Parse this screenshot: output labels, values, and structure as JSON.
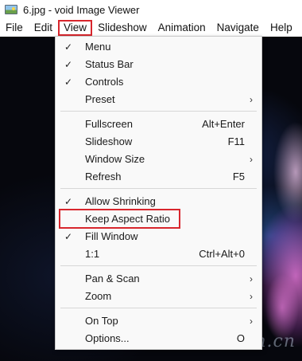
{
  "window": {
    "title": "6.jpg - void Image Viewer"
  },
  "menubar": {
    "items": [
      {
        "label": "File"
      },
      {
        "label": "Edit"
      },
      {
        "label": "View"
      },
      {
        "label": "Slideshow"
      },
      {
        "label": "Animation"
      },
      {
        "label": "Navigate"
      },
      {
        "label": "Help"
      }
    ]
  },
  "view_menu": {
    "items": [
      {
        "label": "Menu",
        "checked": "✓",
        "shortcut": "",
        "arrow": ""
      },
      {
        "label": "Status Bar",
        "checked": "✓",
        "shortcut": "",
        "arrow": ""
      },
      {
        "label": "Controls",
        "checked": "✓",
        "shortcut": "",
        "arrow": ""
      },
      {
        "label": "Preset",
        "checked": "",
        "shortcut": "",
        "arrow": "›"
      },
      {
        "label": "Fullscreen",
        "checked": "",
        "shortcut": "Alt+Enter",
        "arrow": ""
      },
      {
        "label": "Slideshow",
        "checked": "",
        "shortcut": "F11",
        "arrow": ""
      },
      {
        "label": "Window Size",
        "checked": "",
        "shortcut": "",
        "arrow": "›"
      },
      {
        "label": "Refresh",
        "checked": "",
        "shortcut": "F5",
        "arrow": ""
      },
      {
        "label": "Allow Shrinking",
        "checked": "✓",
        "shortcut": "",
        "arrow": ""
      },
      {
        "label": "Keep Aspect Ratio",
        "checked": "",
        "shortcut": "",
        "arrow": ""
      },
      {
        "label": "Fill Window",
        "checked": "✓",
        "shortcut": "",
        "arrow": ""
      },
      {
        "label": "1:1",
        "checked": "",
        "shortcut": "Ctrl+Alt+0",
        "arrow": ""
      },
      {
        "label": "Pan & Scan",
        "checked": "",
        "shortcut": "",
        "arrow": "›"
      },
      {
        "label": "Zoom",
        "checked": "",
        "shortcut": "",
        "arrow": "›"
      },
      {
        "label": "On Top",
        "checked": "",
        "shortcut": "",
        "arrow": "›"
      },
      {
        "label": "Options...",
        "checked": "",
        "shortcut": "O",
        "arrow": ""
      }
    ]
  },
  "watermark": "GitWin.cn"
}
